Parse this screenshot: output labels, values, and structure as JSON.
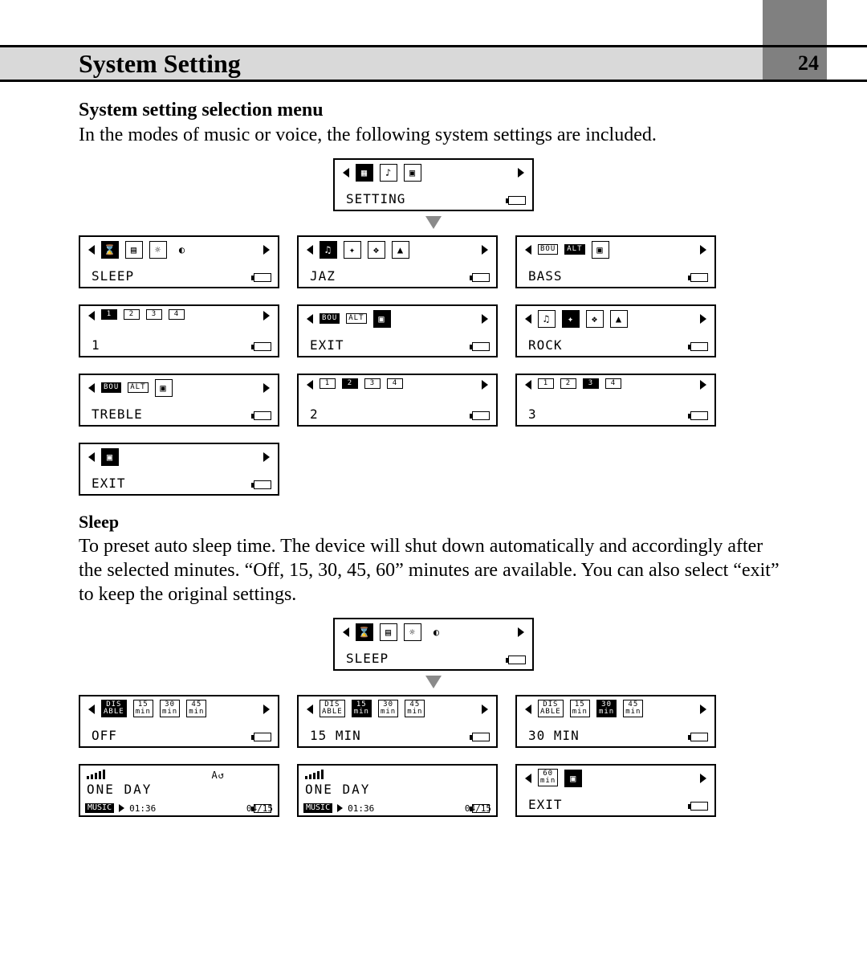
{
  "page": {
    "number": "24"
  },
  "header": {
    "title": "System Setting"
  },
  "section1": {
    "heading": "System setting selection menu",
    "body": "In the modes of music or voice, the following system settings  are included."
  },
  "lcds": {
    "setting": "SETTING",
    "sleep": "SLEEP",
    "jaz": "JAZ",
    "bass": "BASS",
    "one": "1",
    "exit": "EXIT",
    "rock": "ROCK",
    "treble": "TREBLE",
    "two": "2",
    "three": "3",
    "exit2": "EXIT",
    "tags": {
      "bou": "BOU",
      "alt": "ALT",
      "dis": "DIS\nABLE",
      "m15": "15\nmin",
      "m30": "30\nmin",
      "m45": "45\nmin",
      "m60": "60\nmin",
      "p1": "1",
      "p2": "2",
      "p3": "3",
      "p4": "4"
    }
  },
  "section2": {
    "heading": "Sleep",
    "body": "To preset auto sleep time.  The device will shut down automatically and accordingly after the selected minutes. “Off, 15, 30, 45, 60” minutes are available. You can also select “exit” to keep the original settings."
  },
  "sleepLcds": {
    "sleep": "SLEEP",
    "off": "OFF",
    "m15": "15 MIN",
    "m30": "30 MIN",
    "exit": "EXIT"
  },
  "player": {
    "title": "ONE DAY",
    "mode": "MUSIC",
    "time": "01:36",
    "track": "04/15",
    "repeat": "A↺"
  }
}
